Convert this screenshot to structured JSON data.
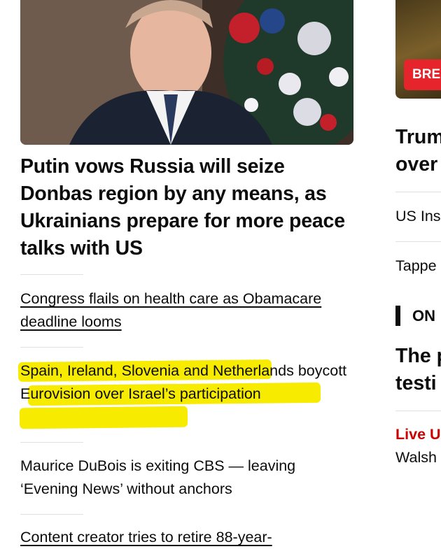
{
  "main": {
    "hero_image_alt": "Vladimir Putin smiling in front of a decorated Christmas tree",
    "headline": "Putin vows Russia will seize Donbas region by any means, as Ukrainians prepare for more peace talks with US",
    "stories": [
      {
        "text": "Congress flails on health care as Obamacare deadline looms"
      },
      {
        "text": "Spain, Ireland, Slovenia and Netherlands boycott Eurovision over Israel’s participation"
      },
      {
        "text": "Maurice DuBois is exiting CBS — leaving ‘Evening News’ without anchors"
      },
      {
        "text": "Content creator tries to retire 88-year-"
      }
    ]
  },
  "side": {
    "badge": "BRE",
    "headline_line1": "Trum",
    "headline_line2": "over",
    "links": [
      "US Ins",
      "Tappe"
    ],
    "section": "ON",
    "section_headline_line1": "The p",
    "section_headline_line2": "testi",
    "live_label": "Live U",
    "live_text": "Walsh"
  },
  "colors": {
    "highlight": "#f7ec00",
    "breaking": "#e5252b",
    "live": "#cc0000"
  }
}
